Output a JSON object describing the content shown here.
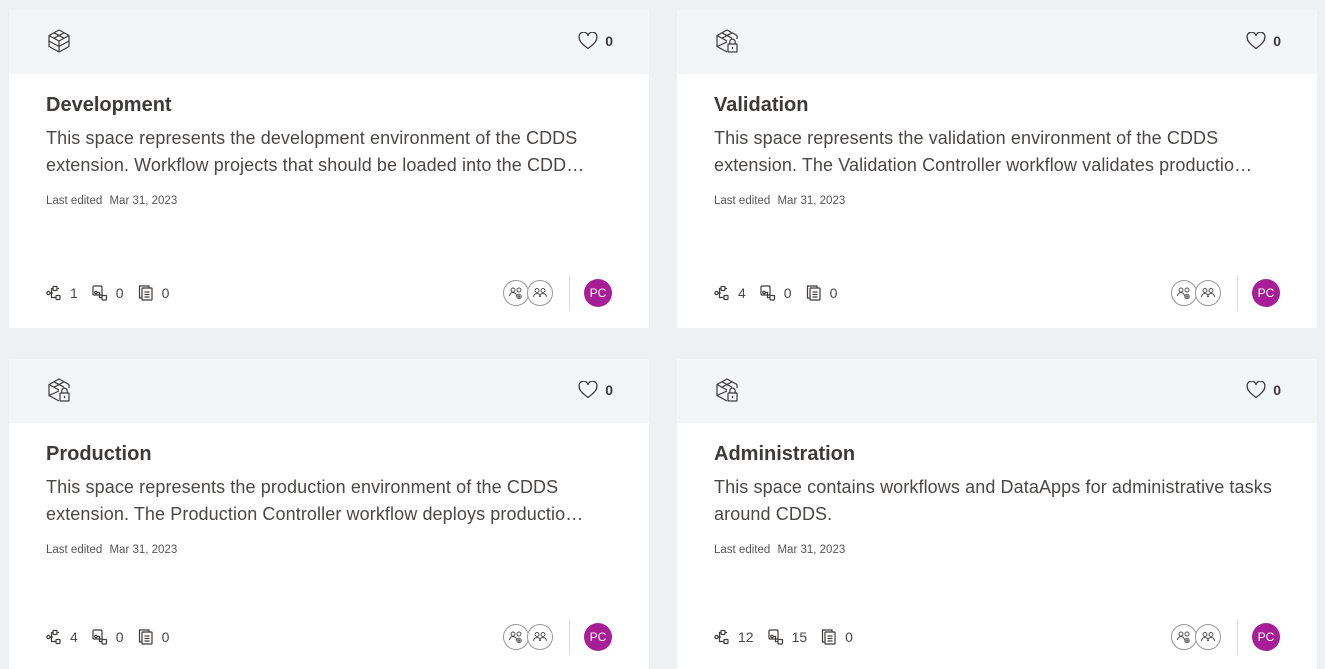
{
  "spaces": [
    {
      "icon": "cube-icon",
      "favorites": "0",
      "title": "Development",
      "description": "This space represents the development environment of the CDDS extension. Workflow projects that should be loaded into the CDD…",
      "edited_label": "Last edited",
      "edited_date": "Mar 31, 2023",
      "workflows": "1",
      "components": "0",
      "files": "0",
      "avatar": "PC"
    },
    {
      "icon": "locked-cube-icon",
      "favorites": "0",
      "title": "Validation",
      "description": "This space represents the validation environment of the CDDS extension. The Validation Controller workflow validates productio…",
      "edited_label": "Last edited",
      "edited_date": "Mar 31, 2023",
      "workflows": "4",
      "components": "0",
      "files": "0",
      "avatar": "PC"
    },
    {
      "icon": "locked-cube-icon",
      "favorites": "0",
      "title": "Production",
      "description": "This space represents the production environment of the CDDS extension. The Production Controller workflow deploys productio…",
      "edited_label": "Last edited",
      "edited_date": "Mar 31, 2023",
      "workflows": "4",
      "components": "0",
      "files": "0",
      "avatar": "PC"
    },
    {
      "icon": "locked-cube-icon",
      "favorites": "0",
      "title": "Administration",
      "description": "This space contains workflows and DataApps for administrative tasks around CDDS.",
      "edited_label": "Last edited",
      "edited_date": "Mar 31, 2023",
      "workflows": "12",
      "components": "15",
      "files": "0",
      "avatar": "PC"
    }
  ],
  "colors": {
    "background": "#eef0f3",
    "card": "#ffffff",
    "card_header": "#f4f5f7",
    "avatar": "#a61f96",
    "text": "#3e3a39"
  }
}
